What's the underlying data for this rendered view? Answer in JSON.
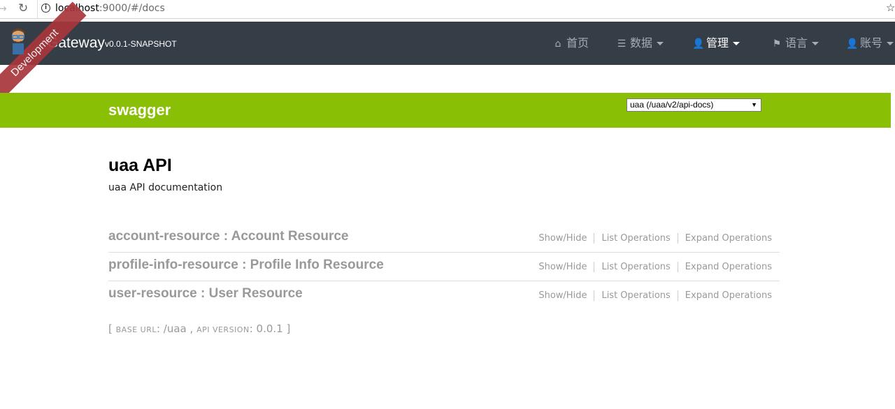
{
  "browser": {
    "url_host": "localhost",
    "url_rest": ":9000/#/docs"
  },
  "navbar": {
    "brand": "Gateway",
    "version": "v0.0.1-SNAPSHOT",
    "ribbon": "Development",
    "items": [
      {
        "label": "首页",
        "icon": "home-icon"
      },
      {
        "label": "数据",
        "icon": "table-icon"
      },
      {
        "label": "管理",
        "icon": "user-plus-icon"
      },
      {
        "label": "语言",
        "icon": "flag-icon"
      },
      {
        "label": "账号",
        "icon": "user-icon"
      }
    ]
  },
  "swagger": {
    "logo": "swagger",
    "selected_api": "uaa (/uaa/v2/api-docs)",
    "color": "#89bf04"
  },
  "api": {
    "title": "uaa API",
    "description": "uaa API documentation"
  },
  "resources": [
    {
      "name": "account-resource : Account Resource"
    },
    {
      "name": "profile-info-resource : Profile Info Resource"
    },
    {
      "name": "user-resource : User Resource"
    }
  ],
  "operations": {
    "show_hide": "Show/Hide",
    "list": "List Operations",
    "expand": "Expand Operations"
  },
  "footer": {
    "open": "[",
    "base_url_label": "base url",
    "base_url": "/uaa",
    "api_version_label": "api version",
    "api_version": "0.0.1",
    "close": "]"
  }
}
